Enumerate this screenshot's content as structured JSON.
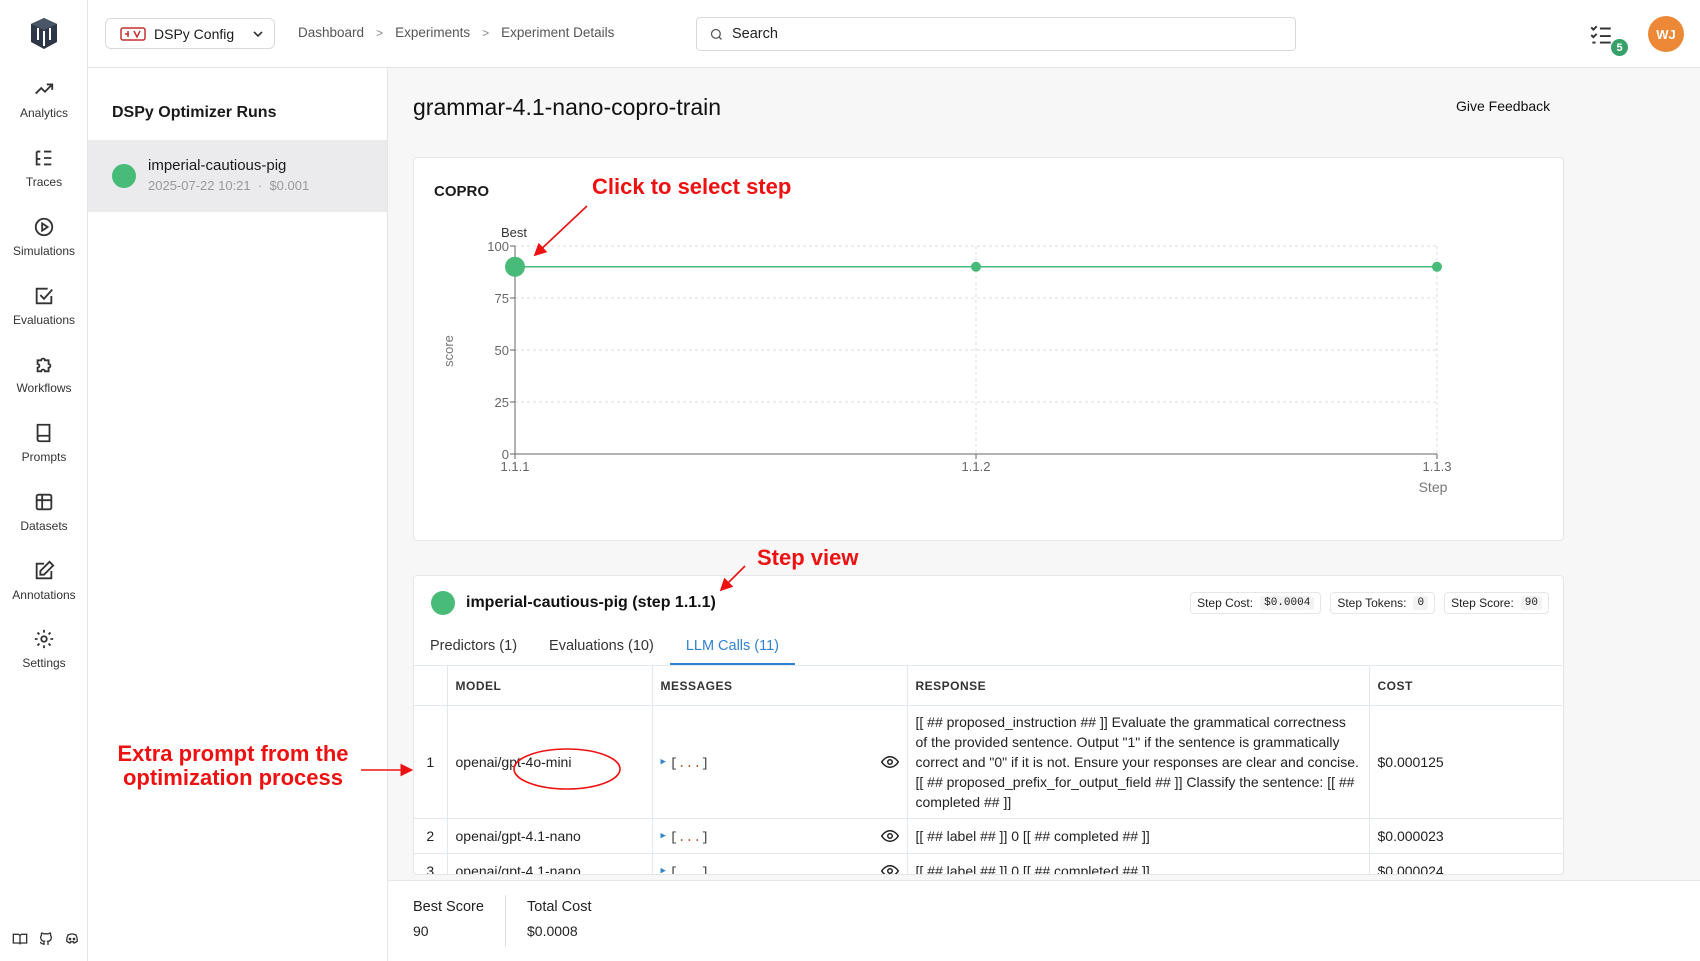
{
  "nav": {
    "items": [
      {
        "label": "Analytics",
        "icon": "trending-up-icon"
      },
      {
        "label": "Traces",
        "icon": "list-tree-icon"
      },
      {
        "label": "Simulations",
        "icon": "play-circle-icon"
      },
      {
        "label": "Evaluations",
        "icon": "check-square-icon"
      },
      {
        "label": "Workflows",
        "icon": "puzzle-icon"
      },
      {
        "label": "Prompts",
        "icon": "book-icon"
      },
      {
        "label": "Datasets",
        "icon": "table-icon"
      },
      {
        "label": "Annotations",
        "icon": "edit-icon"
      },
      {
        "label": "Settings",
        "icon": "gear-icon"
      }
    ]
  },
  "topbar": {
    "project": "DSPy Config",
    "breadcrumb": [
      "Dashboard",
      "Experiments",
      "Experiment Details"
    ],
    "search_placeholder": "Search",
    "tasks_badge": "5",
    "avatar_initials": "WJ",
    "avatar_color": "#ED8936"
  },
  "runs": {
    "heading": "DSPy Optimizer Runs",
    "items": [
      {
        "name": "imperial-cautious-pig",
        "date": "2025-07-22 10:21",
        "cost": "$0.001"
      }
    ]
  },
  "experiment": {
    "title": "grammar-4.1-nano-copro-train",
    "feedback_label": "Give Feedback"
  },
  "chart_data": {
    "type": "line",
    "title": "COPRO",
    "x": [
      "1.1.1",
      "1.1.2",
      "1.1.3"
    ],
    "series": [
      {
        "values": [
          90,
          90,
          90
        ]
      }
    ],
    "ylim": [
      0,
      100
    ],
    "yticks": [
      0,
      25,
      50,
      75,
      100
    ],
    "xlabel": "Step",
    "ylabel": "score",
    "best_label": "Best",
    "best_index": 0,
    "color": "#48BB78",
    "grid": true
  },
  "step": {
    "title": "imperial-cautious-pig (step 1.1.1)",
    "stats": [
      {
        "label": "Step Cost:",
        "value": "$0.0004"
      },
      {
        "label": "Step Tokens:",
        "value": "0"
      },
      {
        "label": "Step Score:",
        "value": "90"
      }
    ],
    "tabs": [
      "Predictors (1)",
      "Evaluations (10)",
      "LLM Calls (11)"
    ],
    "active_tab": 2,
    "columns": [
      "MODEL",
      "MESSAGES",
      "RESPONSE",
      "COST"
    ],
    "rows": [
      {
        "n": "1",
        "model": "openai/gpt-4o-mini",
        "messages": "...",
        "response": "[[ ## proposed_instruction ## ]] Evaluate the grammatical correctness of the provided sentence. Output \"1\" if the sentence is grammatically correct and \"0\" if it is not. Ensure your responses are clear and concise. [[ ## proposed_prefix_for_output_field ## ]] Classify the sentence: [[ ## completed ## ]]",
        "cost": "$0.000125"
      },
      {
        "n": "2",
        "model": "openai/gpt-4.1-nano",
        "messages": "...",
        "response": "[[ ## label ## ]] 0 [[ ## completed ## ]]",
        "cost": "$0.000023"
      },
      {
        "n": "3",
        "model": "openai/gpt-4.1-nano",
        "messages": "...",
        "response": "[[ ## label ## ]] 0 [[ ## completed ## ]]",
        "cost": "$0.000024"
      }
    ]
  },
  "summary": {
    "best_score_label": "Best Score",
    "best_score": "90",
    "total_cost_label": "Total Cost",
    "total_cost": "$0.0008"
  },
  "annotations": {
    "click_to_select": "Click to select step",
    "step_view": "Step view",
    "extra_prompt_line1": "Extra prompt from the",
    "extra_prompt_line2": "optimization process"
  }
}
